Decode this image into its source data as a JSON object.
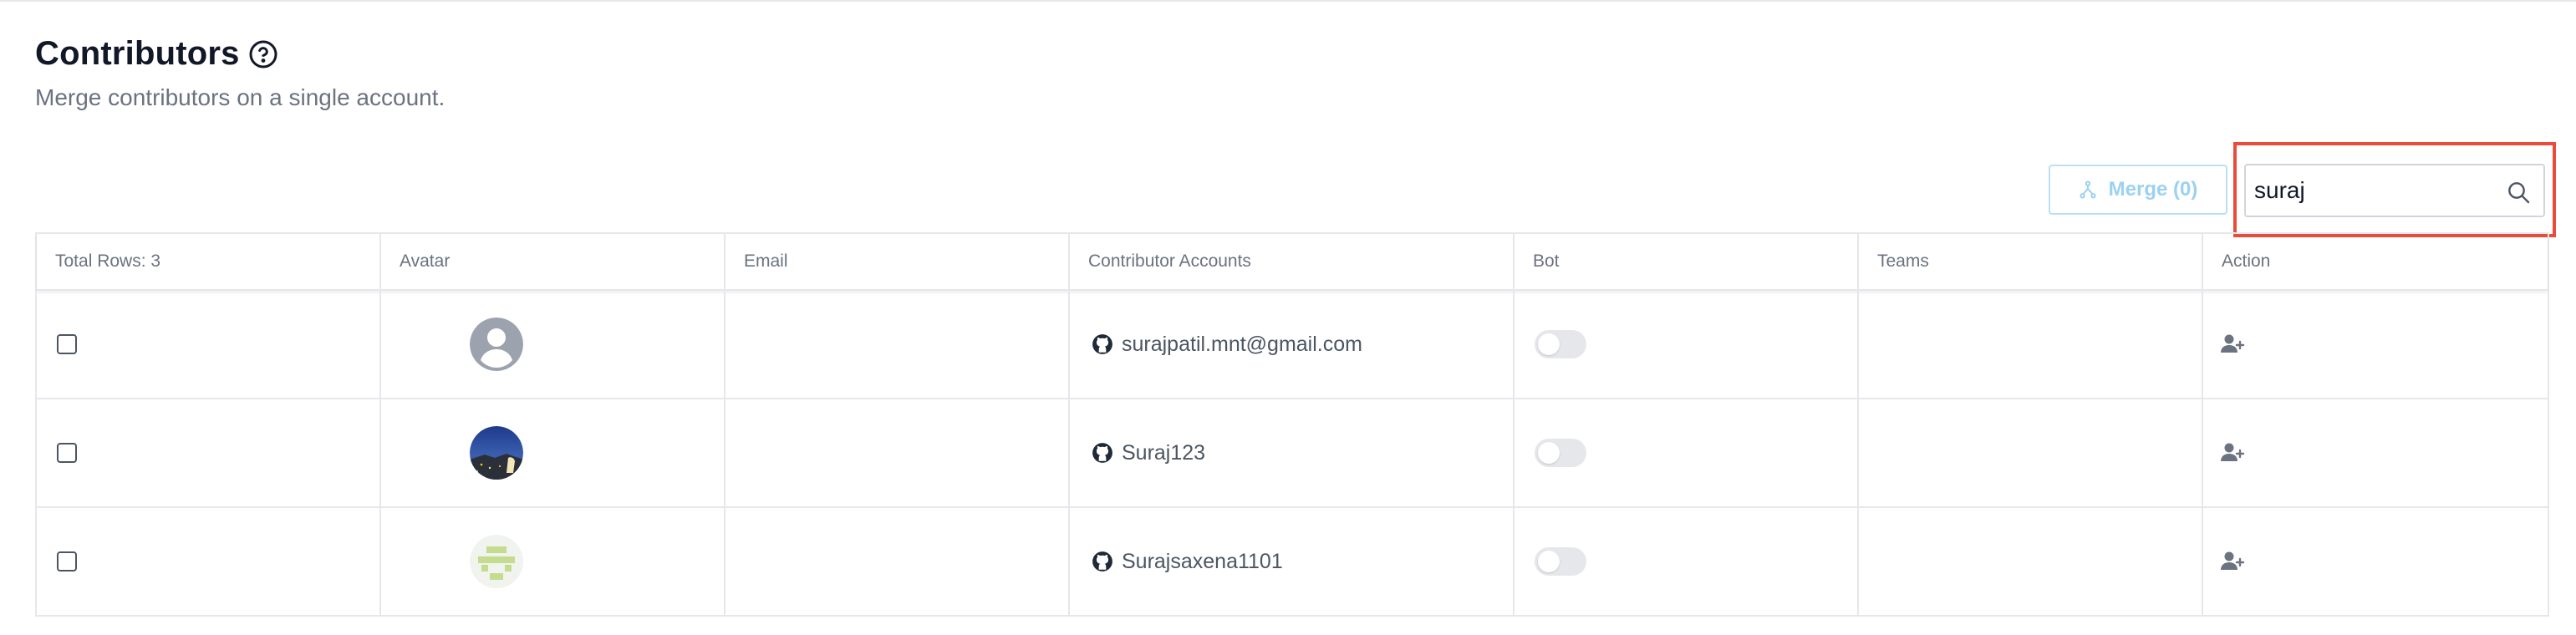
{
  "header": {
    "title": "Contributors",
    "subtitle": "Merge contributors on a single account.",
    "help_icon": "question-circle-icon"
  },
  "toolbar": {
    "merge_label": "Merge (0)",
    "merge_icon": "merge-icon",
    "search_value": "suraj",
    "search_icon": "search-icon"
  },
  "table": {
    "columns": [
      "Total Rows: 3",
      "Avatar",
      "Email",
      "Contributor Accounts",
      "Bot",
      "Teams",
      "Action"
    ],
    "rows": [
      {
        "email": "",
        "account": "surajpatil.mnt@gmail.com",
        "account_icon": "github-icon",
        "avatar": "default-user-avatar",
        "bot": false,
        "teams": "",
        "action_icon": "add-user-icon"
      },
      {
        "email": "",
        "account": "Suraj123",
        "account_icon": "github-icon",
        "avatar": "photo-avatar",
        "bot": false,
        "teams": "",
        "action_icon": "add-user-icon"
      },
      {
        "email": "",
        "account": "Surajsaxena1101",
        "account_icon": "github-icon",
        "avatar": "identicon-avatar",
        "bot": false,
        "teams": "",
        "action_icon": "add-user-icon"
      }
    ]
  },
  "colors": {
    "highlight": "#e74c3c",
    "merge_disabled": "#9bd2f0",
    "text_muted": "#6b7280"
  }
}
